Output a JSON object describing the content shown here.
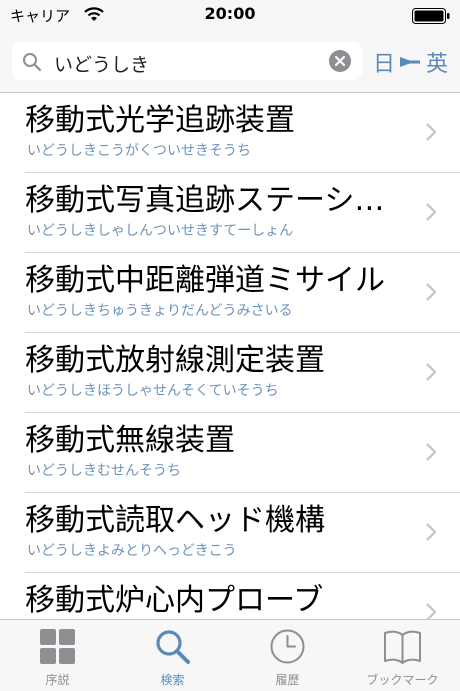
{
  "status": {
    "carrier": "キャリア",
    "time": "20:00"
  },
  "search": {
    "query": "いどうしき"
  },
  "lang_toggle": {
    "from": "日",
    "to": "英"
  },
  "results": [
    {
      "word": "移動式光学追跡装置",
      "reading": "いどうしきこうがくついせきそうち"
    },
    {
      "word": "移動式写真追跡ステーシ…",
      "reading": "いどうしきしゃしんついせきすてーしょん"
    },
    {
      "word": "移動式中距離弾道ミサイル",
      "reading": "いどうしきちゅうきょりだんどうみさいる"
    },
    {
      "word": "移動式放射線測定装置",
      "reading": "いどうしきほうしゃせんそくていそうち"
    },
    {
      "word": "移動式無線装置",
      "reading": "いどうしきむせんそうち"
    },
    {
      "word": "移動式読取ヘッド機構",
      "reading": "いどうしきよみとりへっどきこう"
    },
    {
      "word": "移動式炉心内プローブ",
      "reading": ""
    }
  ],
  "tabs": [
    {
      "label": "序説",
      "icon": "grid-icon",
      "active": false
    },
    {
      "label": "検索",
      "icon": "search-icon",
      "active": true
    },
    {
      "label": "履歴",
      "icon": "clock-icon",
      "active": false
    },
    {
      "label": "ブックマーク",
      "icon": "book-icon",
      "active": false
    }
  ],
  "colors": {
    "accent": "#5b8ab8",
    "reading": "#6f93b7",
    "inactive": "#8e8e93",
    "bar_background": "#f7f7f7"
  }
}
